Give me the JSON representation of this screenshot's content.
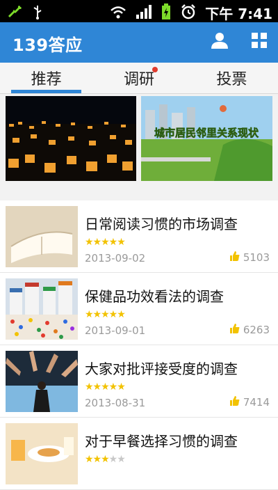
{
  "status_bar": {
    "time": "下午 7:41",
    "icons": [
      "signal-arrows-icon",
      "usb-icon",
      "wifi-icon",
      "signal-bars-icon",
      "battery-charging-icon",
      "alarm-icon"
    ]
  },
  "header": {
    "title": "139答应",
    "icons": [
      "user-icon",
      "grid-icon"
    ],
    "accent_color": "#2f86d6"
  },
  "tabs": [
    {
      "label": "推荐",
      "active": true
    },
    {
      "label": "调研",
      "badge": true
    },
    {
      "label": "投票"
    }
  ],
  "banners": [
    {
      "image": "lantern-night-photo"
    },
    {
      "image": "residential-park-photo",
      "text": "城市居民邻里关系现状"
    }
  ],
  "surveys": [
    {
      "title": "日常阅读习惯的市场调查",
      "stars": 5,
      "date": "2013-09-02",
      "votes": "5103",
      "thumb": "open-book-photo"
    },
    {
      "title": "保健品功效看法的调查",
      "stars": 5,
      "date": "2013-09-01",
      "votes": "6263",
      "thumb": "pill-bottles-photo"
    },
    {
      "title": "大家对批评接受度的调查",
      "stars": 5,
      "date": "2013-08-31",
      "votes": "7414",
      "thumb": "pointing-hands-photo"
    },
    {
      "title": "对于早餐选择习惯的调查",
      "stars": 3,
      "date": "",
      "votes": "",
      "thumb": "breakfast-photo"
    }
  ]
}
